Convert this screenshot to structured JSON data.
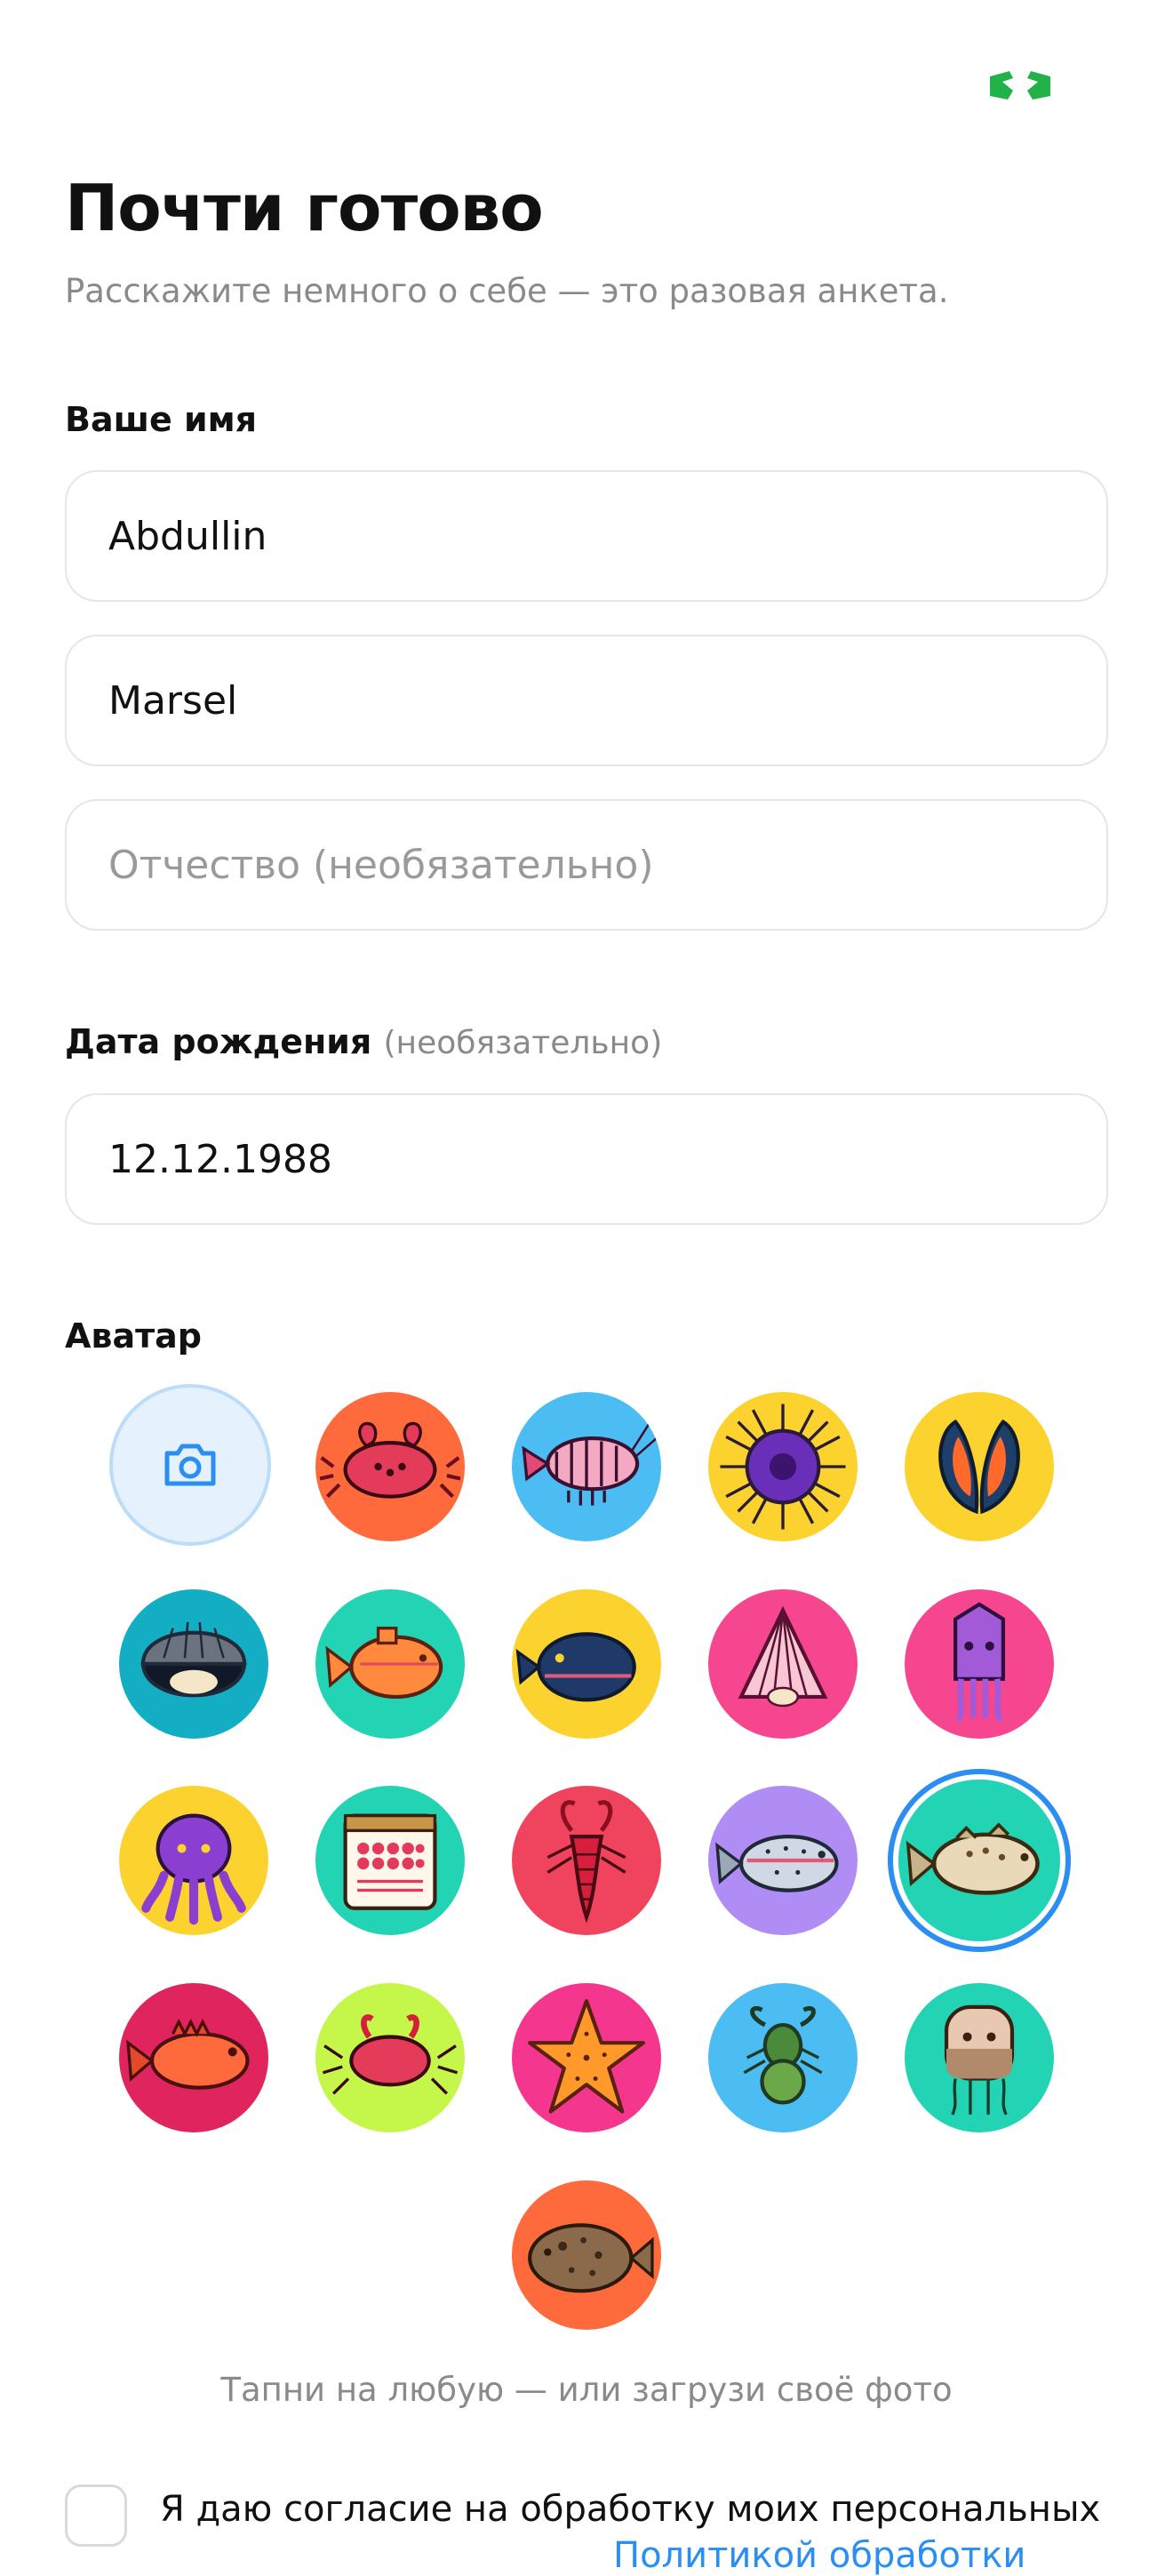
{
  "header": {
    "title": "Почти готово",
    "subtitle": "Расскажите немного о себе — это разовая анкета."
  },
  "name_section": {
    "label": "Ваше имя",
    "last_name": "Abdullin",
    "first_name": "Marsel",
    "patronymic_placeholder": "Отчество (необязательно)"
  },
  "birth_section": {
    "label": "Дата рождения",
    "optional": "(необязательно)",
    "value": "12.12.1988"
  },
  "avatar_section": {
    "label": "Аватар",
    "hint": "Тапни на любую — или загрузи своё фото"
  },
  "consent": {
    "text": "Я даю согласие на обработку моих персональных",
    "link": "Политикой обработки"
  },
  "colors": {
    "accent": "#2a8ef2",
    "brand_green": "#21b24a"
  }
}
